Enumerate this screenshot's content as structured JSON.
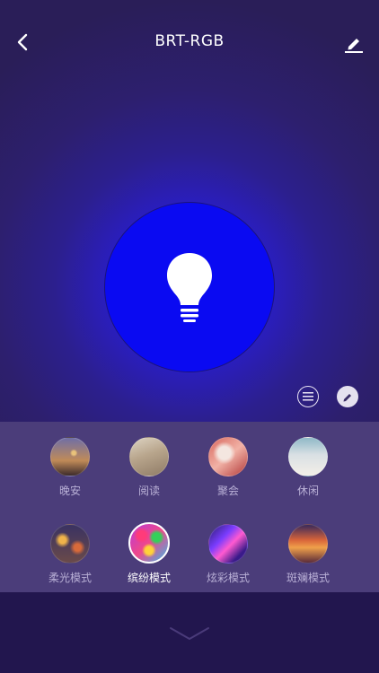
{
  "header": {
    "title": "BRT-RGB",
    "back_icon": "chevron-left-icon",
    "edit_icon": "edit-pencil-icon"
  },
  "light": {
    "color": "#0a0af2",
    "icon": "lightbulb-icon"
  },
  "controls": {
    "list_icon": "list-icon",
    "pencil_icon": "pencil-icon"
  },
  "modes": {
    "items": [
      {
        "label": "晚安",
        "selected": false
      },
      {
        "label": "阅读",
        "selected": false
      },
      {
        "label": "聚会",
        "selected": false
      },
      {
        "label": "休闲",
        "selected": false
      },
      {
        "label": "柔光模式",
        "selected": false
      },
      {
        "label": "缤纷模式",
        "selected": true
      },
      {
        "label": "炫彩模式",
        "selected": false
      },
      {
        "label": "斑斓模式",
        "selected": false
      }
    ]
  },
  "footer": {
    "collapse_icon": "chevron-down-icon"
  },
  "colors": {
    "accent": "#0a0af2",
    "panel": "#4b3d7a",
    "background": "#2b1f5a"
  }
}
